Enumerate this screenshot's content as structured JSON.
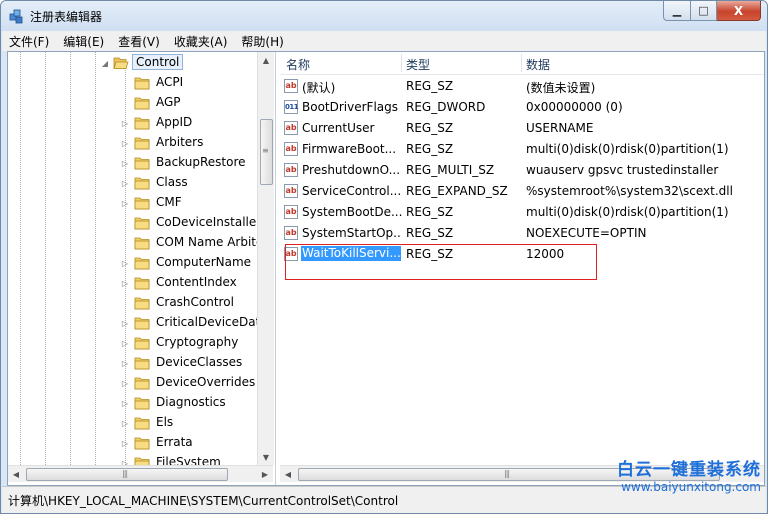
{
  "window": {
    "title": "注册表编辑器",
    "caption": {
      "minimize": "▁",
      "maximize": "□",
      "close": "X"
    }
  },
  "menubar": [
    {
      "label": "文件(F)"
    },
    {
      "label": "编辑(E)"
    },
    {
      "label": "查看(V)"
    },
    {
      "label": "收藏夹(A)"
    },
    {
      "label": "帮助(H)"
    }
  ],
  "tree": {
    "selected_parent": "Control",
    "children": [
      {
        "label": "ACPI",
        "expandable": false
      },
      {
        "label": "AGP",
        "expandable": false
      },
      {
        "label": "AppID",
        "expandable": true
      },
      {
        "label": "Arbiters",
        "expandable": true
      },
      {
        "label": "BackupRestore",
        "expandable": true
      },
      {
        "label": "Class",
        "expandable": true
      },
      {
        "label": "CMF",
        "expandable": true
      },
      {
        "label": "CoDeviceInstallers",
        "expandable": false
      },
      {
        "label": "COM Name Arbite",
        "expandable": false
      },
      {
        "label": "ComputerName",
        "expandable": true
      },
      {
        "label": "ContentIndex",
        "expandable": true
      },
      {
        "label": "CrashControl",
        "expandable": false
      },
      {
        "label": "CriticalDeviceDatal",
        "expandable": true
      },
      {
        "label": "Cryptography",
        "expandable": true
      },
      {
        "label": "DeviceClasses",
        "expandable": true
      },
      {
        "label": "DeviceOverrides",
        "expandable": true
      },
      {
        "label": "Diagnostics",
        "expandable": true
      },
      {
        "label": "Els",
        "expandable": true
      },
      {
        "label": "Errata",
        "expandable": true
      },
      {
        "label": "FileSystem",
        "expandable": true
      }
    ]
  },
  "list": {
    "columns": {
      "name": "名称",
      "type": "类型",
      "data": "数据"
    },
    "rows": [
      {
        "icon": "ab",
        "name": "(默认)",
        "type": "REG_SZ",
        "data": "(数值未设置)"
      },
      {
        "icon": "bin",
        "name": "BootDriverFlags",
        "type": "REG_DWORD",
        "data": "0x00000000 (0)"
      },
      {
        "icon": "ab",
        "name": "CurrentUser",
        "type": "REG_SZ",
        "data": "USERNAME"
      },
      {
        "icon": "ab",
        "name": "FirmwareBoot...",
        "type": "REG_SZ",
        "data": "multi(0)disk(0)rdisk(0)partition(1)"
      },
      {
        "icon": "ab",
        "name": "PreshutdownO...",
        "type": "REG_MULTI_SZ",
        "data": "wuauserv gpsvc trustedinstaller"
      },
      {
        "icon": "ab",
        "name": "ServiceControl...",
        "type": "REG_EXPAND_SZ",
        "data": "%systemroot%\\system32\\scext.dll"
      },
      {
        "icon": "ab",
        "name": "SystemBootDe...",
        "type": "REG_SZ",
        "data": "multi(0)disk(0)rdisk(0)partition(1)"
      },
      {
        "icon": "ab",
        "name": "SystemStartOp...",
        "type": "REG_SZ",
        "data": " NOEXECUTE=OPTIN"
      },
      {
        "icon": "ab",
        "name": "WaitToKillServi...",
        "type": "REG_SZ",
        "data": "12000",
        "editing": true
      }
    ]
  },
  "statusbar": {
    "path": "计算机\\HKEY_LOCAL_MACHINE\\SYSTEM\\CurrentControlSet\\Control"
  },
  "watermark": {
    "title": "白云一键重装系统",
    "url": "www.baiyunxitong.com"
  },
  "colors": {
    "selection": "#3399ff",
    "highlight_box": "#e02020",
    "watermark": "#1e6fd9"
  }
}
